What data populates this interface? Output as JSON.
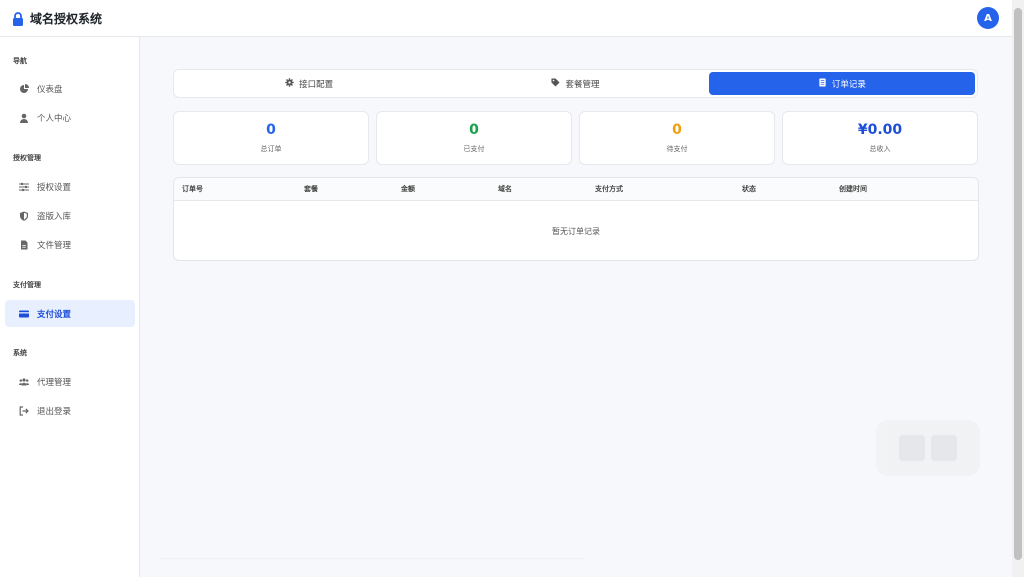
{
  "app": {
    "title": "域名授权系统",
    "avatar_letter": "A"
  },
  "sidebar": {
    "sections": [
      {
        "label": "导航",
        "items": [
          {
            "label": "仪表盘",
            "icon": "pie-chart-icon"
          },
          {
            "label": "个人中心",
            "icon": "user-icon"
          }
        ]
      },
      {
        "label": "授权管理",
        "items": [
          {
            "label": "授权设置",
            "icon": "sliders-icon"
          },
          {
            "label": "盗版入库",
            "icon": "shield-icon"
          },
          {
            "label": "文件管理",
            "icon": "file-icon"
          }
        ]
      },
      {
        "label": "支付管理",
        "items": [
          {
            "label": "支付设置",
            "icon": "credit-card-icon",
            "active": true
          }
        ]
      },
      {
        "label": "系统",
        "items": [
          {
            "label": "代理管理",
            "icon": "users-icon"
          },
          {
            "label": "退出登录",
            "icon": "logout-icon"
          }
        ]
      }
    ]
  },
  "tabs": [
    {
      "label": "接口配置",
      "icon": "gear-icon"
    },
    {
      "label": "套餐管理",
      "icon": "tag-icon"
    },
    {
      "label": "订单记录",
      "icon": "receipt-icon",
      "active": true
    }
  ],
  "stats": [
    {
      "value": "0",
      "label": "总订单",
      "color": "#2563eb"
    },
    {
      "value": "0",
      "label": "已支付",
      "color": "#16a34a"
    },
    {
      "value": "0",
      "label": "待支付",
      "color": "#f59e0b"
    },
    {
      "value": "¥0.00",
      "label": "总收入",
      "color": "#1d4ed8"
    }
  ],
  "table": {
    "columns": [
      "订单号",
      "套餐",
      "金额",
      "域名",
      "支付方式",
      "状态",
      "创建时间"
    ],
    "empty_text": "暂无订单记录"
  },
  "colors": {
    "accent": "#2563eb",
    "active_bg": "#e8efff"
  }
}
